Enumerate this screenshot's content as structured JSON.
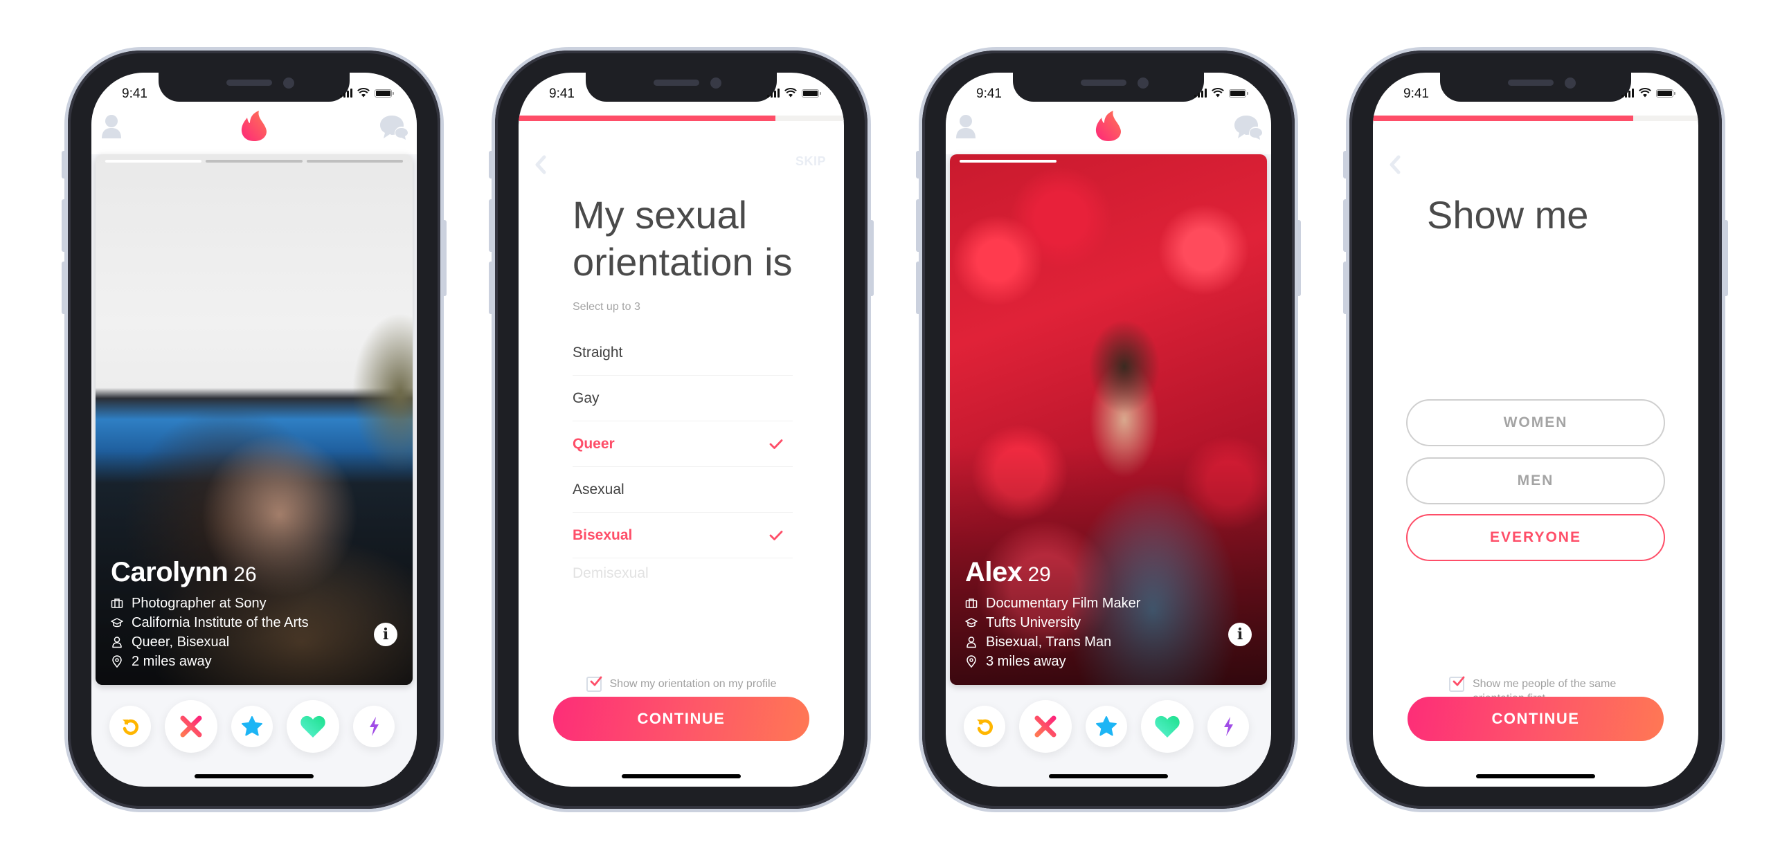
{
  "status_bar": {
    "time": "9:41"
  },
  "colors": {
    "brand": "#fe4e68",
    "gradient_start": "#fd2d78",
    "gradient_end": "#ff7854"
  },
  "screens": [
    {
      "type": "profile-card",
      "header": {
        "left_icon": "profile-icon",
        "center_icon": "tinder-flame-icon",
        "right_icon": "messages-icon"
      },
      "photo_count": 3,
      "active_photo": 1,
      "profile": {
        "name": "Carolynn",
        "age": "26",
        "details": [
          {
            "icon": "briefcase-icon",
            "text": "Photographer at Sony"
          },
          {
            "icon": "graduation-cap-icon",
            "text": "California Institute of the Arts"
          },
          {
            "icon": "person-icon",
            "text": "Queer, Bisexual"
          },
          {
            "icon": "location-pin-icon",
            "text": "2 miles away"
          }
        ],
        "info_label": "i"
      },
      "actions": [
        "rewind",
        "nope",
        "super-like",
        "like",
        "boost"
      ]
    },
    {
      "type": "orientation",
      "progress_percent": 79,
      "skip_label": "SKIP",
      "title": "My sexual orientation is",
      "subtitle": "Select up to 3",
      "options": [
        {
          "label": "Straight",
          "selected": false
        },
        {
          "label": "Gay",
          "selected": false
        },
        {
          "label": "Queer",
          "selected": true
        },
        {
          "label": "Asexual",
          "selected": false
        },
        {
          "label": "Bisexual",
          "selected": true
        },
        {
          "label": "Demisexual",
          "selected": false
        }
      ],
      "checkbox_label": "Show my orientation on my profile",
      "checkbox_checked": true,
      "continue_label": "CONTINUE"
    },
    {
      "type": "profile-card",
      "header": {
        "left_icon": "profile-icon",
        "center_icon": "tinder-flame-icon",
        "right_icon": "messages-icon"
      },
      "photo_count": 1,
      "active_photo": 1,
      "profile": {
        "name": "Alex",
        "age": "29",
        "details": [
          {
            "icon": "briefcase-icon",
            "text": "Documentary Film Maker"
          },
          {
            "icon": "graduation-cap-icon",
            "text": "Tufts University"
          },
          {
            "icon": "person-icon",
            "text": "Bisexual, Trans Man"
          },
          {
            "icon": "location-pin-icon",
            "text": "3 miles away"
          }
        ],
        "info_label": "i"
      },
      "actions": [
        "rewind",
        "nope",
        "super-like",
        "like",
        "boost"
      ]
    },
    {
      "type": "show-me",
      "progress_percent": 80,
      "title": "Show me",
      "options": [
        {
          "label": "WOMEN",
          "selected": false
        },
        {
          "label": "MEN",
          "selected": false
        },
        {
          "label": "EVERYONE",
          "selected": true
        }
      ],
      "checkbox_label_line1": "Show me people of the same",
      "checkbox_label_line2": "orientation first",
      "checkbox_checked": true,
      "continue_label": "CONTINUE"
    }
  ]
}
